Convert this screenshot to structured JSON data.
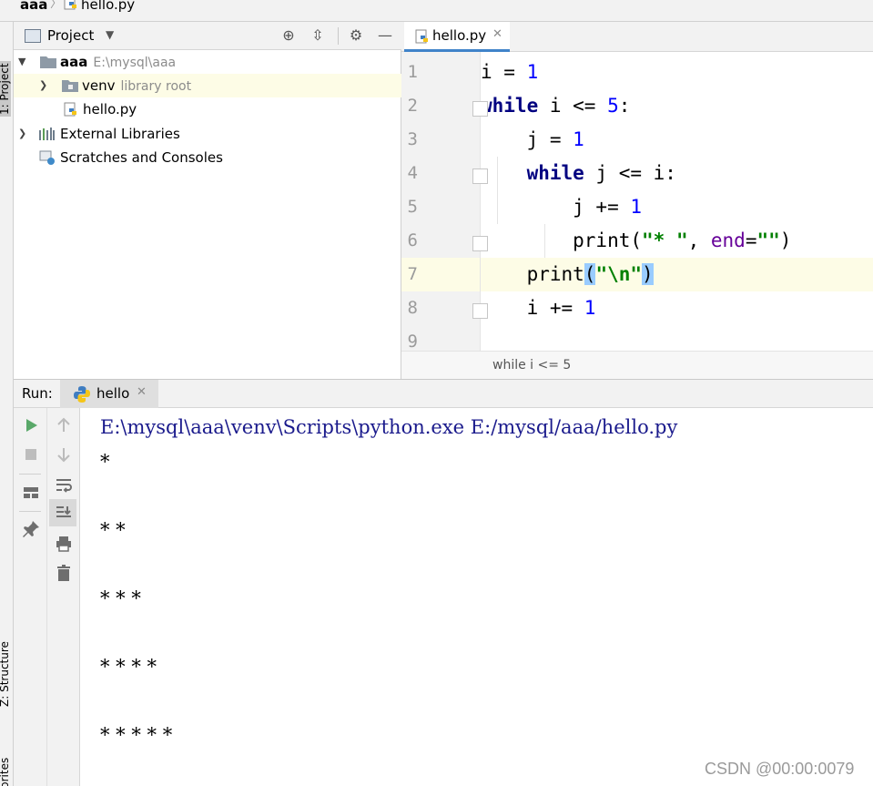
{
  "breadcrumb": {
    "project": "aaa",
    "separator": "〉",
    "file": "hello.py"
  },
  "left_strip": {
    "project_tab": "1: Project",
    "structure_tab": "Z: Structure",
    "favorites_tab": "Favorites"
  },
  "project_panel": {
    "title": "Project",
    "tree": [
      {
        "label": "aaa",
        "path": "E:\\mysql\\aaa"
      },
      {
        "label": "venv",
        "path": "library root"
      },
      {
        "label": "hello.py"
      },
      {
        "label": "External Libraries"
      },
      {
        "label": "Scratches and Consoles"
      }
    ]
  },
  "editor": {
    "tab_label": "hello.py",
    "line_numbers": [
      "1",
      "2",
      "3",
      "4",
      "5",
      "6",
      "7",
      "8",
      "9"
    ],
    "status_breadcrumb": "while i <= 5",
    "colors": {
      "keyword": "#000080",
      "number": "#0000ff",
      "string": "#008000",
      "param": "#660099",
      "current_line": "#fdfce6",
      "brace_match": "#99ccff"
    }
  },
  "run_panel": {
    "label": "Run:",
    "tab_label": "hello",
    "command": "E:\\mysql\\aaa\\venv\\Scripts\\python.exe E:/mysql/aaa/hello.py",
    "output_lines": [
      "*",
      "* *",
      "* * *",
      "* * * *",
      "* * * * *"
    ]
  },
  "watermark": "CSDN @00:00:0079",
  "icons": {
    "run": "play-icon",
    "stop": "stop-icon",
    "layout": "layout-icon",
    "pin": "pin-icon",
    "up": "arrow-up-icon",
    "down": "arrow-down-icon",
    "wrap": "soft-wrap-icon",
    "scroll": "scroll-to-end-icon",
    "print": "print-icon",
    "trash": "trash-icon"
  }
}
